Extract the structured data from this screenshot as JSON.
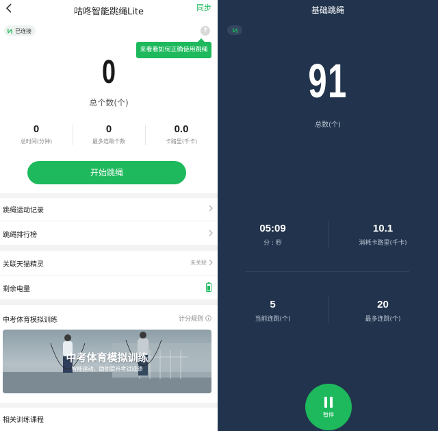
{
  "left": {
    "header": {
      "title": "咕咚智能跳绳Lite",
      "sync_label": "同步"
    },
    "connection": {
      "status": "已连接"
    },
    "help": {
      "symbol": "?",
      "tip": "来看看如何正确使用跳绳"
    },
    "summary": {
      "count": "0",
      "count_label": "总个数(个)"
    },
    "stats": [
      {
        "value": "0",
        "label": "总时间(分钟)"
      },
      {
        "value": "0",
        "label": "最多连跳个数"
      },
      {
        "value": "0.0",
        "label": "卡路里(千卡)"
      }
    ],
    "start_button": "开始跳绳",
    "menu": {
      "records": "跳绳运动记录",
      "ranking": "跳绳排行榜",
      "tmall": {
        "label": "关联天猫精灵",
        "value": "未关联"
      },
      "battery": {
        "label": "剩余电量"
      }
    },
    "exam": {
      "title": "中考体育模拟训练",
      "rule": "计分规则",
      "banner_title": "中考体育模拟训练",
      "banner_subtitle": "智能运动，助你提升考试成绩"
    },
    "related_courses": "相关训练课程"
  },
  "right": {
    "title": "基础跳绳",
    "count": "91",
    "count_label": "总数(个)",
    "metrics": [
      {
        "value": "05:09",
        "label": "分 : 秒"
      },
      {
        "value": "10.1",
        "label": "消耗卡路里(千卡)"
      },
      {
        "value": "5",
        "label": "当前连跳(个)"
      },
      {
        "value": "20",
        "label": "最多连跳(个)"
      }
    ],
    "pause_label": "暂停"
  },
  "colors": {
    "accent": "#1db95c",
    "dark_bg": "#22344d",
    "text_dark": "#1a1a1a",
    "text_muted": "#888888"
  }
}
